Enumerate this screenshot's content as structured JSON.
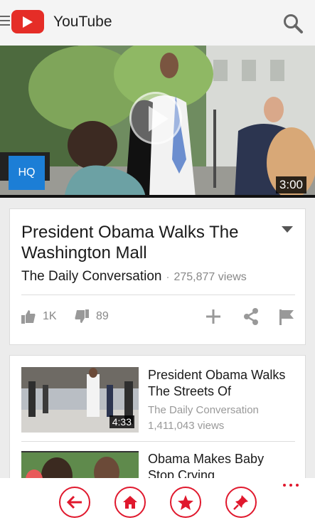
{
  "app": {
    "title": "YouTube"
  },
  "player": {
    "quality_badge": "HQ",
    "duration": "3:00"
  },
  "video": {
    "title": "President Obama Walks The Washington Mall",
    "channel": "The Daily Conversation",
    "separator": "·",
    "views": "275,877 views",
    "likes": "1K",
    "dislikes": "89"
  },
  "related": [
    {
      "title": "President Obama Walks The Streets Of",
      "channel": "The Daily Conversation",
      "views": "1,411,043 views",
      "duration": "4:33"
    },
    {
      "title": "Obama Makes Baby Stop Crying",
      "channel": "",
      "views": "",
      "duration": ""
    }
  ],
  "colors": {
    "brand": "#e52d27",
    "accent": "#e0182d",
    "badge": "#1c7ed6"
  },
  "icons": [
    "menu-icon",
    "youtube-logo-icon",
    "search-icon",
    "play-icon",
    "dropdown-icon",
    "thumbs-up-icon",
    "thumbs-down-icon",
    "add-icon",
    "share-icon",
    "flag-icon",
    "back-icon",
    "home-icon",
    "star-icon",
    "pin-icon",
    "more-icon"
  ]
}
